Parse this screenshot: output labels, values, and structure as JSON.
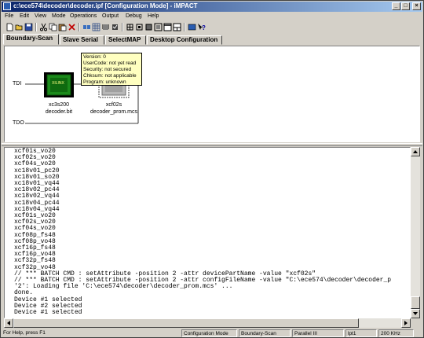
{
  "window": {
    "title": "c:\\ece574\\decoder\\decoder.ipf [Configuration Mode] - iMPACT",
    "controls": [
      "_",
      "□",
      "×"
    ]
  },
  "menu": [
    "File",
    "Edit",
    "View",
    "Mode",
    "Operations",
    "Output",
    "Debug",
    "Help"
  ],
  "toolbar": {
    "icons": [
      "new-icon",
      "open-icon",
      "save-icon",
      "cut-icon",
      "copy-icon",
      "paste-icon",
      "delete-icon",
      "chain-icon",
      "grid-icon",
      "program-icon",
      "verify-icon",
      "erase-icon",
      "readback-icon",
      "device-icon",
      "boundary-icon",
      "window-icon",
      "output-icon",
      "help-icon"
    ]
  },
  "tabs": [
    "Boundary-Scan",
    "Slave Serial",
    "SelectMAP",
    "Desktop Configuration"
  ],
  "active_tab": "Boundary-Scan",
  "diagram": {
    "tdi_label": "TDI",
    "tdo_label": "TDO",
    "devices": [
      {
        "name": "xc3s200",
        "file": "decoder.bit",
        "chip_label": "XILINX",
        "color": "#1b8a1b",
        "selected": true
      },
      {
        "name": "xcf02s",
        "file": "decoder_prom.mcs",
        "chip_label": "",
        "color": "#b8b8b8",
        "selected": false
      }
    ],
    "tooltip": [
      "Version: 0",
      "UserCode: not yet read",
      "Security: not secured",
      "Chksum: not applicable",
      "Program: unknown"
    ]
  },
  "console": {
    "lines": [
      "xcf01s_vo20",
      "xcf02s_vo20",
      "xcf04s_vo20",
      "xc18v01_pc20",
      "xc18v01_so20",
      "xc18v01_vq44",
      "xc18v02_pc44",
      "xc18v02_vq44",
      "xc18v04_pc44",
      "xc18v04_vq44",
      "xcf01s_vo20",
      "xcf02s_vo20",
      "xcf04s_vo20",
      "xcf08p_fs48",
      "xcf08p_vo48",
      "xcf16p_fs48",
      "xcf16p_vo48",
      "xcf32p_fs48",
      "xcf32p_vo48",
      "// *** BATCH CMD : setAttribute -position 2 -attr devicePartName -value \"xcf02s\"",
      "// *** BATCH CMD : setAttribute -position 2 -attr configFileName -value \"C:\\ece574\\decoder\\decoder_p",
      "'2': Loading file 'C:\\ece574\\decoder\\decoder_prom.mcs' ...",
      "done.",
      "Device #1 selected",
      "Device #2 selected",
      "Device #1 selected"
    ]
  },
  "status": {
    "help": "For Help, press F1",
    "cells": [
      "Configuration Mode",
      "Boundary-Scan",
      "Parallel III",
      "lpt1",
      "200 KHz"
    ]
  }
}
